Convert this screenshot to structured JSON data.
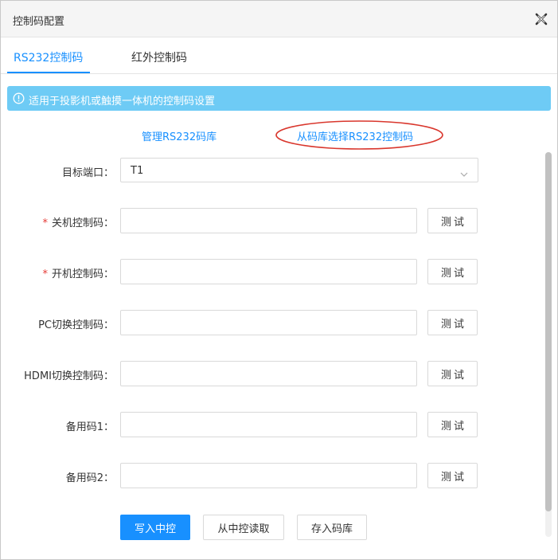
{
  "dialog": {
    "title": "控制码配置",
    "close_icon": "close-icon"
  },
  "tabs": [
    {
      "label": "RS232控制码",
      "active": true
    },
    {
      "label": "红外控制码",
      "active": false
    }
  ],
  "alert": {
    "icon": "info-circle-icon",
    "text": "适用于投影机或触摸一体机的控制码设置"
  },
  "links": {
    "manage_library": "管理RS232码库",
    "select_from_library": "从码库选择RS232控制码"
  },
  "form": {
    "target_port": {
      "label": "目标端口：",
      "value": "T1"
    },
    "fields": [
      {
        "label": "关机控制码：",
        "required": true,
        "value": ""
      },
      {
        "label": "开机控制码：",
        "required": true,
        "value": ""
      },
      {
        "label": "PC切换控制码：",
        "required": false,
        "value": ""
      },
      {
        "label": "HDMI切换控制码：",
        "required": false,
        "value": ""
      },
      {
        "label": "备用码1：",
        "required": false,
        "value": ""
      },
      {
        "label": "备用码2：",
        "required": false,
        "value": ""
      }
    ],
    "required_mark": "*",
    "test_label": "测试"
  },
  "actions": {
    "write": "写入中控",
    "read": "从中控读取",
    "save": "存入码库"
  },
  "colors": {
    "accent": "#1890ff",
    "alert_bg": "#6ecbf5",
    "required": "#e53935",
    "annotation": "#d9362c"
  }
}
